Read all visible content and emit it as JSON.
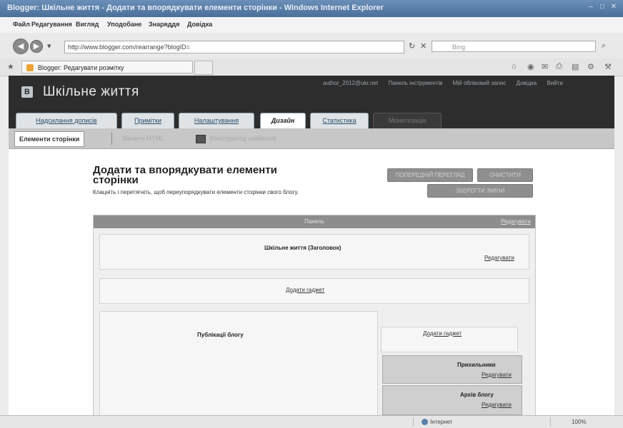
{
  "window": {
    "title": "Blogger: Шкільне життя - Додати та впорядкувати елементи сторінки - Windows Internet Explorer"
  },
  "menu": [
    "Файл",
    "Редагування",
    "Вигляд",
    "Уподобане",
    "Знаряддя",
    "Довідка"
  ],
  "address": {
    "url": "http://www.blogger.com/rearrange?blogID=",
    "search_placeholder": "Bing"
  },
  "browser_tab": {
    "label": "Blogger: Редагувати розмітку"
  },
  "blog": {
    "title": "Шкільне життя",
    "top_links": [
      "author_2012@ukr.net",
      "Панель інструментів",
      "Мій обліковий запис",
      "Довідка",
      "Вийти"
    ]
  },
  "tabs": {
    "posting": "Надсилання дописів",
    "comments": "Примітки",
    "settings": "Налаштування",
    "design": "Дизайн",
    "stats": "Статистика",
    "monetize": "Монетизація"
  },
  "subtabs": {
    "page_elements": "Елементи сторінки",
    "edit_html": "Змінити HTML",
    "template_designer": "Конструктор шаблонів"
  },
  "page": {
    "heading": "Додати та впорядкувати елементи сторінки",
    "description": "Клацніть і перетягніть, щоб переупорядкувати елементи сторінки свого блогу."
  },
  "buttons": {
    "preview": "ПОПЕРЕДНІЙ ПЕРЕГЛЯД",
    "clear": "ОЧИСТИТИ",
    "save": "ЗБЕРЕГТИ ЗМІНИ"
  },
  "layout": {
    "navbar_title": "Панель",
    "navbar_edit": "Редагувати",
    "header_label": "Шкільне життя (Заголовок)",
    "header_edit": "Редагувати",
    "add_gadget_1": "Додати гаджет",
    "blog_posts": "Публікації блогу",
    "add_gadget_2": "Додати гаджет",
    "followers": "Прихильники",
    "followers_edit": "Редагувати",
    "archive": "Архів блогу",
    "archive_edit": "Редагувати"
  },
  "status": {
    "zone": "Інтернет",
    "zoom": "100%"
  }
}
